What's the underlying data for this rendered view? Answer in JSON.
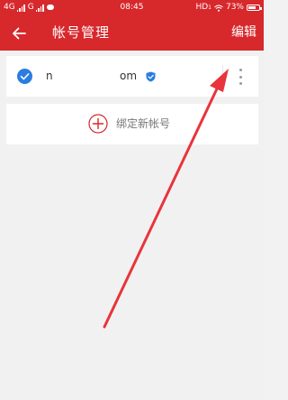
{
  "status_bar": {
    "network_label": "4G",
    "network_label_2": "G",
    "time": "08:45",
    "hd_label": "HD",
    "hd_sub": "1",
    "battery_text": "73%",
    "battery_level": 0.73
  },
  "app_bar": {
    "back_icon": "back-arrow-icon",
    "title": "帐号管理",
    "edit_label": "编辑"
  },
  "account": {
    "name_prefix": "n",
    "name_suffix": "om",
    "selected": true,
    "verified": true,
    "more_icon": "more-vertical-icon"
  },
  "bind": {
    "label": "绑定新帐号",
    "icon": "plus-circle-icon"
  },
  "colors": {
    "brand_red": "#d7282c",
    "check_blue": "#2b7de0",
    "annotation_red": "#e8343c"
  }
}
